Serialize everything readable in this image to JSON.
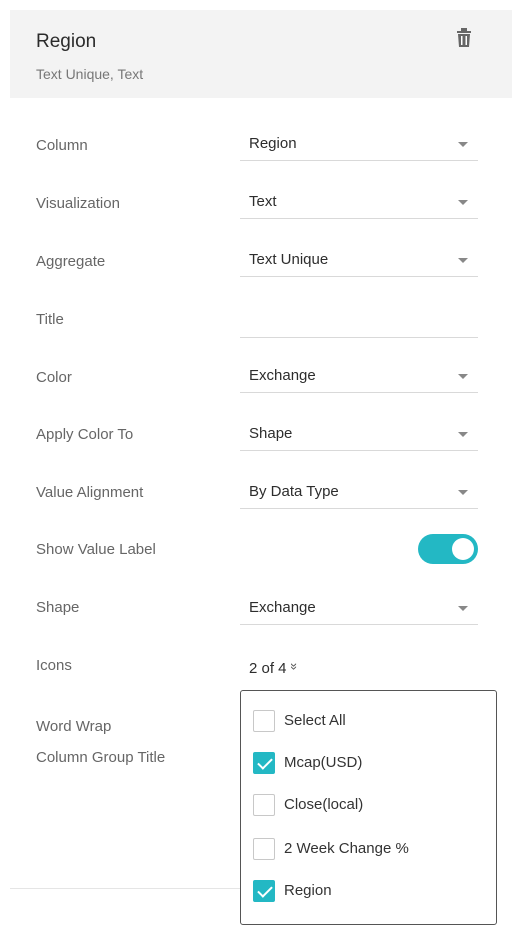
{
  "header": {
    "title": "Region",
    "subtitle": "Text Unique, Text",
    "delete_icon": "trash-icon"
  },
  "rows": [
    {
      "label": "Column",
      "value": "Region",
      "type": "select"
    },
    {
      "label": "Visualization",
      "value": "Text",
      "type": "select"
    },
    {
      "label": "Aggregate",
      "value": "Text Unique",
      "type": "select"
    },
    {
      "label": "Title",
      "value": "",
      "type": "text"
    },
    {
      "label": "Color",
      "value": "Exchange",
      "type": "select"
    },
    {
      "label": "Apply Color To",
      "value": "Shape",
      "type": "select"
    },
    {
      "label": "Value Alignment",
      "value": "By Data Type",
      "type": "select"
    },
    {
      "label": "Show Value Label",
      "type": "toggle",
      "on": true
    },
    {
      "label": "Shape",
      "value": "Exchange",
      "type": "select"
    },
    {
      "label": "Icons",
      "value": "2 of 4",
      "type": "multiselect"
    },
    {
      "label": "Word Wrap"
    },
    {
      "label": "Column Group Title"
    }
  ],
  "icons_dropdown": {
    "arrow": "»",
    "options": [
      {
        "label": "Select All",
        "checked": false
      },
      {
        "label": "Mcap(USD)",
        "checked": true
      },
      {
        "label": "Close(local)",
        "checked": false
      },
      {
        "label": "2 Week Change %",
        "checked": false
      },
      {
        "label": "Region",
        "checked": true
      }
    ]
  },
  "colors": {
    "accent": "#23b8c4",
    "header_bg": "#f3f3f3"
  }
}
